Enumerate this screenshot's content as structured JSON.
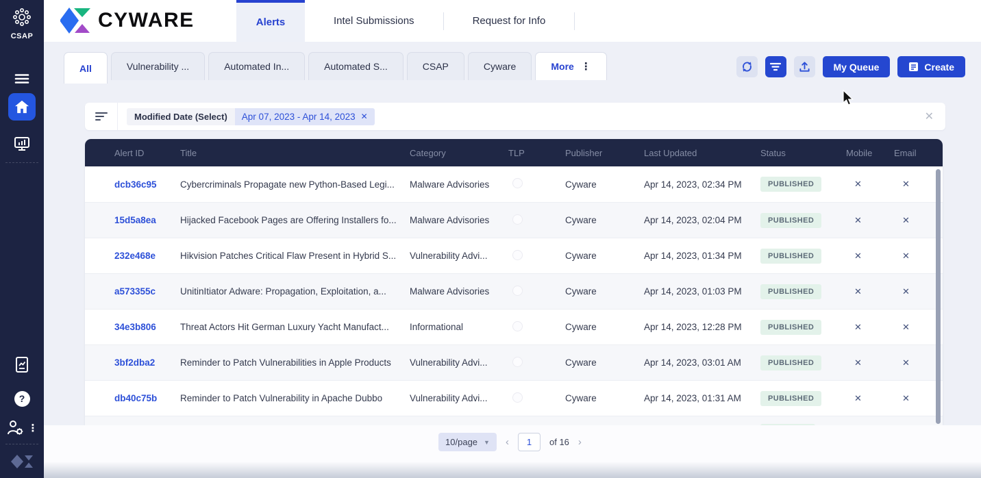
{
  "sidebar": {
    "product": "CSAP"
  },
  "header": {
    "brand": "CYWARE",
    "tabs": [
      {
        "label": "Alerts",
        "active": true
      },
      {
        "label": "Intel Submissions",
        "active": false
      },
      {
        "label": "Request for Info",
        "active": false
      }
    ]
  },
  "toolbar": {
    "tabs": [
      {
        "label": "All",
        "active": true
      },
      {
        "label": "Vulnerability ...",
        "active": false
      },
      {
        "label": "Automated In...",
        "active": false
      },
      {
        "label": "Automated S...",
        "active": false
      },
      {
        "label": "CSAP",
        "active": false
      },
      {
        "label": "Cyware",
        "active": false
      }
    ],
    "more_label": "More",
    "my_queue_label": "My Queue",
    "create_label": "Create"
  },
  "filter_bar": {
    "field_label": "Modified Date (Select)",
    "date_chip": "Apr 07, 2023 - Apr 14, 2023"
  },
  "table": {
    "columns": [
      "Alert ID",
      "Title",
      "Category",
      "TLP",
      "Publisher",
      "Last Updated",
      "Status",
      "Mobile",
      "Email"
    ],
    "rows": [
      {
        "id": "dcb36c95",
        "title": "Cybercriminals Propagate new Python-Based Legi...",
        "category": "Malware Advisories",
        "publisher": "Cyware",
        "updated": "Apr 14, 2023, 02:34 PM",
        "status": "PUBLISHED"
      },
      {
        "id": "15d5a8ea",
        "title": "Hijacked Facebook Pages are Offering Installers fo...",
        "category": "Malware Advisories",
        "publisher": "Cyware",
        "updated": "Apr 14, 2023, 02:04 PM",
        "status": "PUBLISHED"
      },
      {
        "id": "232e468e",
        "title": "Hikvision Patches Critical Flaw Present in Hybrid S...",
        "category": "Vulnerability Advi...",
        "publisher": "Cyware",
        "updated": "Apr 14, 2023, 01:34 PM",
        "status": "PUBLISHED"
      },
      {
        "id": "a573355c",
        "title": "UnitinItiator Adware: Propagation, Exploitation, a...",
        "category": "Malware Advisories",
        "publisher": "Cyware",
        "updated": "Apr 14, 2023, 01:03 PM",
        "status": "PUBLISHED"
      },
      {
        "id": "34e3b806",
        "title": "Threat Actors Hit German Luxury Yacht Manufact...",
        "category": "Informational",
        "publisher": "Cyware",
        "updated": "Apr 14, 2023, 12:28 PM",
        "status": "PUBLISHED"
      },
      {
        "id": "3bf2dba2",
        "title": "Reminder to Patch Vulnerabilities in Apple Products",
        "category": "Vulnerability Advi...",
        "publisher": "Cyware",
        "updated": "Apr 14, 2023, 03:01 AM",
        "status": "PUBLISHED"
      },
      {
        "id": "db40c75b",
        "title": "Reminder to Patch Vulnerability in Apache Dubbo",
        "category": "Vulnerability Advi...",
        "publisher": "Cyware",
        "updated": "Apr 14, 2023, 01:31 AM",
        "status": "PUBLISHED"
      }
    ]
  },
  "pagination": {
    "page_size": "10/page",
    "page": "1",
    "of_label": "of 16"
  },
  "colors": {
    "accent_blue": "#2547d0",
    "navy": "#1c2342",
    "table_header_navy": "#1f2745",
    "link_blue": "#2d50d8",
    "badge_bg": "#e3f2ea",
    "badge_text": "#5d6b78",
    "page_bg": "#eef0f7"
  }
}
